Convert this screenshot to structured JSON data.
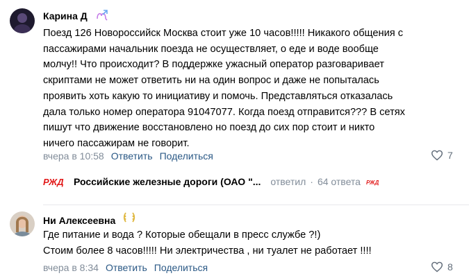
{
  "comments": [
    {
      "author": "Карина Д",
      "badge_icon": "zodiac-sign-icon",
      "text": "Поезд 126 Новороссийск Москва стоит уже 10 часов!!!!! Никакого общения с\nпассажирами начальник поезда не осуществляет, о еде и воде вообще\nмолчу!! Что происходит? В поддержке ужасный оператор разговаривает\nскриптами не может ответить ни на один вопрос и даже не попыталась\nпроявить хоть какую то инициативу и помочь. Представляться отказалась\nдала только номер оператора 91047077. Когда поезд отправится??? В сетях\nпишут что движение восстановлено но поезд до сих пор стоит и никто\nничего пассажирам не говорит.",
      "time": "вчера в 10:58",
      "reply_label": "Ответить",
      "share_label": "Поделиться",
      "likes": "7",
      "reply_preview": {
        "name": "Российские железные дороги (ОАО \"...",
        "action": "ответил",
        "count": "64 ответа"
      }
    },
    {
      "author": "Ни Алексеевна",
      "badge_icon": "laurel-wreath-icon",
      "text": "Где питание и вода ? Которые обещали в пресс службе ?!)\nСтоим более 8 часов!!!!! Ни электричества , ни туалет не работает !!!!",
      "time": "вчера в 8:34",
      "reply_label": "Ответить",
      "share_label": "Поделиться",
      "likes": "8"
    }
  ],
  "colors": {
    "link": "#2a5885",
    "meta": "#818c99",
    "rzd_red": "#e21a1a"
  }
}
